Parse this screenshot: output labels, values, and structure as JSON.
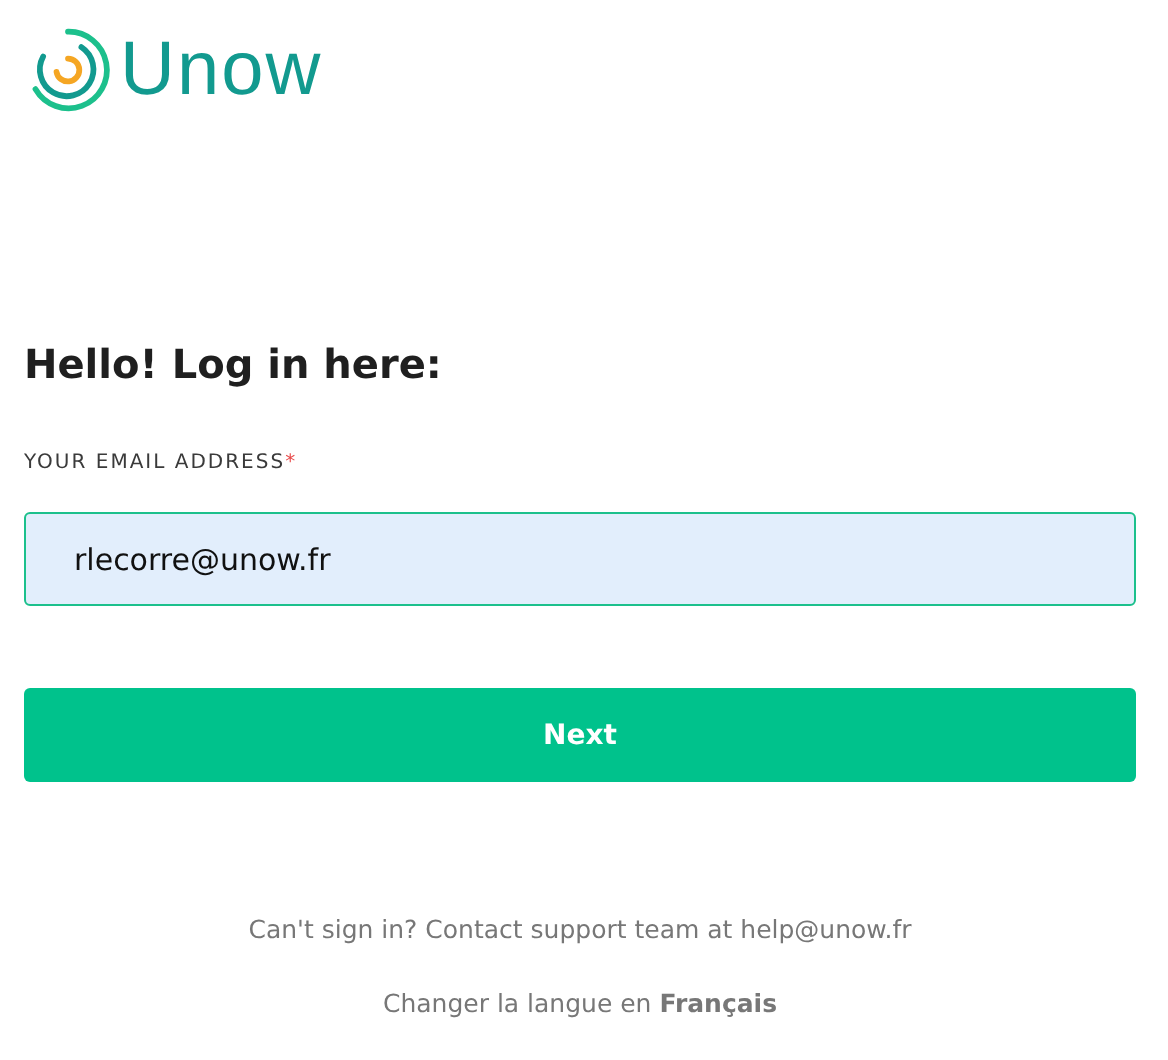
{
  "logo": {
    "text": "Unow"
  },
  "heading": "Hello! Log in here:",
  "email_field": {
    "label": "YOUR EMAIL ADDRESS",
    "required_mark": "*",
    "value": "rlecorre@unow.fr"
  },
  "next_button": "Next",
  "support_text": "Can't sign in? Contact support team at help@unow.fr",
  "language_text": "Changer la langue en **Français**"
}
